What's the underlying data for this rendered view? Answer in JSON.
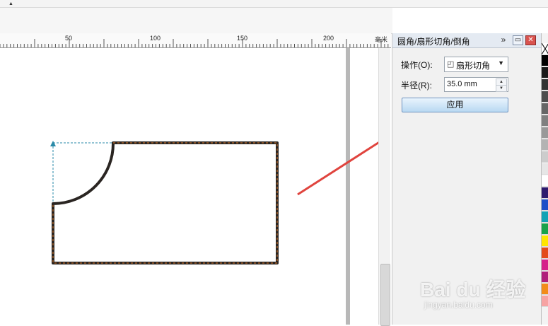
{
  "ruler": {
    "ticks": [
      "50",
      "100",
      "150",
      "200"
    ],
    "unit": "毫米"
  },
  "docker": {
    "title": "圆角/扇形切角/倒角",
    "more_glyph": "»",
    "operation_label": "操作(O):",
    "operation_value": "扇形切角",
    "radius_label": "半径(R):",
    "radius_value": "35.0 mm",
    "apply_label": "应用"
  },
  "palette": {
    "colors": [
      "#ffffff",
      "#000000",
      "#1a1a1a",
      "#333333",
      "#4d4d4d",
      "#666666",
      "#808080",
      "#999999",
      "#b3b3b3",
      "#cccccc",
      "#e6e6e6",
      "#ffffff",
      "#2e1a6e",
      "#1f4fc8",
      "#12a3b5",
      "#19a34a",
      "#ffe600",
      "#e34a1b",
      "#d61f8a",
      "#b01f7a",
      "#f28c1a",
      "#f7a3a3"
    ]
  },
  "watermark": {
    "brand": "Bai du 经验",
    "site": "jingyan.baidu.com"
  },
  "colors": {
    "arrow": "#e0443e",
    "shape_stroke": "#2a2522",
    "guide": "#2a8aa8"
  }
}
